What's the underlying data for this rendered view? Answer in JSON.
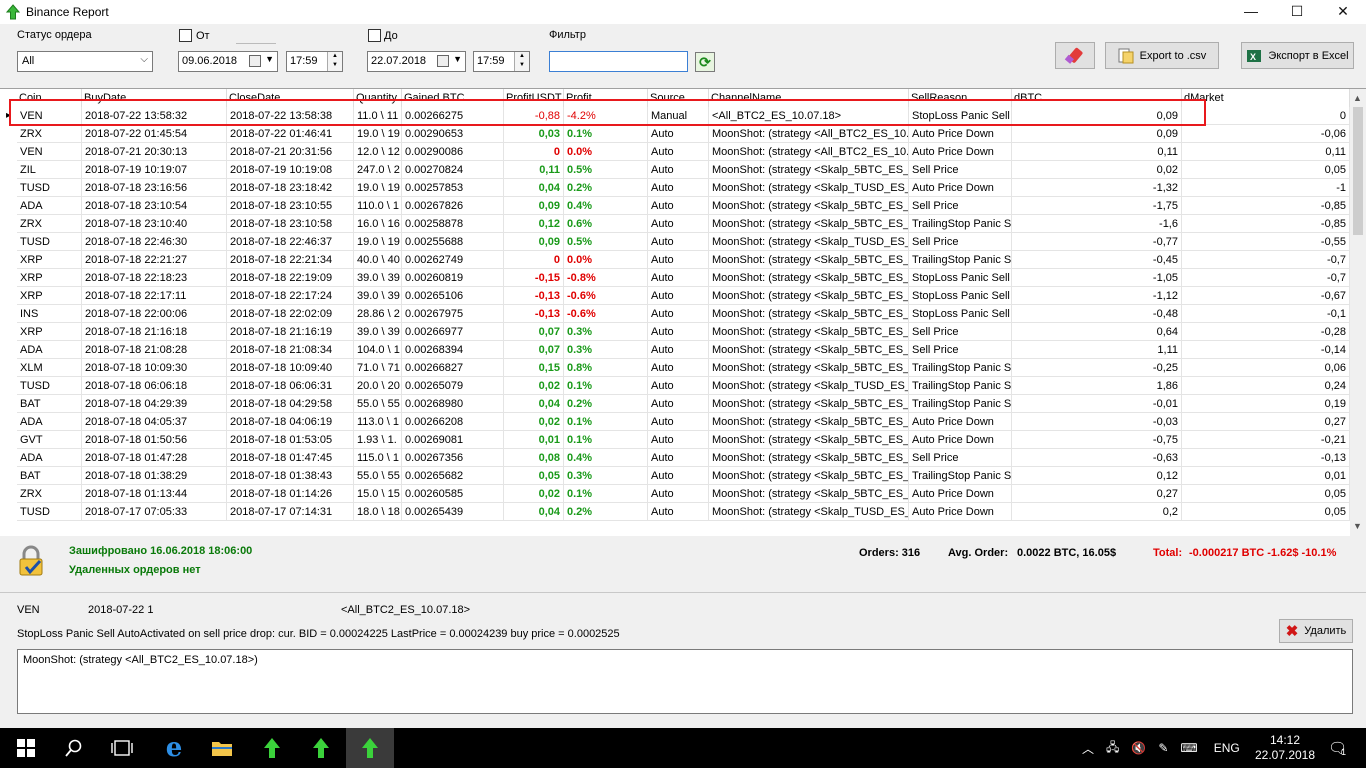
{
  "window": {
    "title": "Binance Report",
    "minimize": "—",
    "maximize": "☐",
    "close": "✕"
  },
  "filters": {
    "status_label": "Статус ордера",
    "status_value": "All",
    "from_label": "От",
    "from_date": "09.06.2018",
    "from_time": "17:59",
    "to_label": "До",
    "to_date": "22.07.2018",
    "to_time": "17:59",
    "filter_label": "Фильтр",
    "filter_value": ""
  },
  "buttons": {
    "export_csv": "Export to .csv",
    "export_excel": "Экспорт в Excel",
    "delete": "Удалить"
  },
  "columns": [
    "Coin",
    "BuyDate",
    "CloseDate",
    "Quantity",
    "Gained BTC",
    "ProfitUSDT",
    "Profit",
    "Source",
    "ChannelName",
    "SellReason",
    "dBTC",
    "dMarket"
  ],
  "rows": [
    [
      "VEN",
      "2018-07-22 13:58:32",
      "2018-07-22 13:58:38",
      "11.0 \\ 11",
      "0.00266275",
      "-0,88",
      "-4.2%",
      "Manual",
      "<All_BTC2_ES_10.07.18>",
      "StopLoss Panic Sell A",
      "0,09",
      "0"
    ],
    [
      "ZRX",
      "2018-07-22 01:45:54",
      "2018-07-22 01:46:41",
      "19.0 \\ 19",
      "0.00290653",
      "0,03",
      "0.1%",
      "Auto",
      "MoonShot: (strategy <All_BTC2_ES_10.0",
      "Auto Price Down",
      "0,09",
      "-0,06"
    ],
    [
      "VEN",
      "2018-07-21 20:30:13",
      "2018-07-21 20:31:56",
      "12.0 \\ 12",
      "0.00290086",
      "0",
      "0.0%",
      "Auto",
      "MoonShot: (strategy <All_BTC2_ES_10.0",
      "Auto Price Down",
      "0,11",
      "0,11"
    ],
    [
      "ZIL",
      "2018-07-19 10:19:07",
      "2018-07-19 10:19:08",
      "247.0 \\ 2",
      "0.00270824",
      "0,11",
      "0.5%",
      "Auto",
      "MoonShot: (strategy <Skalp_5BTC_ES_0",
      "Sell Price",
      "0,02",
      "0,05"
    ],
    [
      "TUSD",
      "2018-07-18 23:16:56",
      "2018-07-18 23:18:42",
      "19.0 \\ 19",
      "0.00257853",
      "0,04",
      "0.2%",
      "Auto",
      "MoonShot: (strategy <Skalp_TUSD_ES_(",
      "Auto Price Down",
      "-1,32",
      "-1"
    ],
    [
      "ADA",
      "2018-07-18 23:10:54",
      "2018-07-18 23:10:55",
      "110.0 \\ 1",
      "0.00267826",
      "0,09",
      "0.4%",
      "Auto",
      "MoonShot: (strategy <Skalp_5BTC_ES_0",
      "Sell Price",
      "-1,75",
      "-0,85"
    ],
    [
      "ZRX",
      "2018-07-18 23:10:40",
      "2018-07-18 23:10:58",
      "16.0 \\ 16",
      "0.00258878",
      "0,12",
      "0.6%",
      "Auto",
      "MoonShot: (strategy <Skalp_5BTC_ES_0",
      "TrailingStop Panic Se",
      "-1,6",
      "-0,85"
    ],
    [
      "TUSD",
      "2018-07-18 22:46:30",
      "2018-07-18 22:46:37",
      "19.0 \\ 19",
      "0.00255688",
      "0,09",
      "0.5%",
      "Auto",
      "MoonShot: (strategy <Skalp_TUSD_ES_(",
      "Sell Price",
      "-0,77",
      "-0,55"
    ],
    [
      "XRP",
      "2018-07-18 22:21:27",
      "2018-07-18 22:21:34",
      "40.0 \\ 40",
      "0.00262749",
      "0",
      "0.0%",
      "Auto",
      "MoonShot: (strategy <Skalp_5BTC_ES_0",
      "TrailingStop Panic Se",
      "-0,45",
      "-0,7"
    ],
    [
      "XRP",
      "2018-07-18 22:18:23",
      "2018-07-18 22:19:09",
      "39.0 \\ 39",
      "0.00260819",
      "-0,15",
      "-0.8%",
      "Auto",
      "MoonShot: (strategy <Skalp_5BTC_ES_0",
      "StopLoss Panic Sell A",
      "-1,05",
      "-0,7"
    ],
    [
      "XRP",
      "2018-07-18 22:17:11",
      "2018-07-18 22:17:24",
      "39.0 \\ 39",
      "0.00265106",
      "-0,13",
      "-0.6%",
      "Auto",
      "MoonShot: (strategy <Skalp_5BTC_ES_0",
      "StopLoss Panic Sell A",
      "-1,12",
      "-0,67"
    ],
    [
      "INS",
      "2018-07-18 22:00:06",
      "2018-07-18 22:02:09",
      "28.86 \\ 2",
      "0.00267975",
      "-0,13",
      "-0.6%",
      "Auto",
      "MoonShot: (strategy <Skalp_5BTC_ES_0",
      "StopLoss Panic Sell A",
      "-0,48",
      "-0,1"
    ],
    [
      "XRP",
      "2018-07-18 21:16:18",
      "2018-07-18 21:16:19",
      "39.0 \\ 39",
      "0.00266977",
      "0,07",
      "0.3%",
      "Auto",
      "MoonShot: (strategy <Skalp_5BTC_ES_0",
      "Sell Price",
      "0,64",
      "-0,28"
    ],
    [
      "ADA",
      "2018-07-18 21:08:28",
      "2018-07-18 21:08:34",
      "104.0 \\ 1",
      "0.00268394",
      "0,07",
      "0.3%",
      "Auto",
      "MoonShot: (strategy <Skalp_5BTC_ES_(",
      "Sell Price",
      "1,11",
      "-0,14"
    ],
    [
      "XLM",
      "2018-07-18 10:09:30",
      "2018-07-18 10:09:40",
      "71.0 \\ 71",
      "0.00266827",
      "0,15",
      "0.8%",
      "Auto",
      "MoonShot: (strategy <Skalp_5BTC_ES_0",
      "TrailingStop Panic Se",
      "-0,25",
      "0,06"
    ],
    [
      "TUSD",
      "2018-07-18 06:06:18",
      "2018-07-18 06:06:31",
      "20.0 \\ 20",
      "0.00265079",
      "0,02",
      "0.1%",
      "Auto",
      "MoonShot: (strategy <Skalp_TUSD_ES_(",
      "TrailingStop Panic Se",
      "1,86",
      "0,24"
    ],
    [
      "BAT",
      "2018-07-18 04:29:39",
      "2018-07-18 04:29:58",
      "55.0 \\ 55",
      "0.00268980",
      "0,04",
      "0.2%",
      "Auto",
      "MoonShot: (strategy <Skalp_5BTC_ES_0",
      "TrailingStop Panic Se",
      "-0,01",
      "0,19"
    ],
    [
      "ADA",
      "2018-07-18 04:05:37",
      "2018-07-18 04:06:19",
      "113.0 \\ 1",
      "0.00266208",
      "0,02",
      "0.1%",
      "Auto",
      "MoonShot: (strategy <Skalp_5BTC_ES_0",
      "Auto Price Down",
      "-0,03",
      "0,27"
    ],
    [
      "GVT",
      "2018-07-18 01:50:56",
      "2018-07-18 01:53:05",
      "1.93 \\ 1.",
      "0.00269081",
      "0,01",
      "0.1%",
      "Auto",
      "MoonShot: (strategy <Skalp_5BTC_ES_0",
      "Auto Price Down",
      "-0,75",
      "-0,21"
    ],
    [
      "ADA",
      "2018-07-18 01:47:28",
      "2018-07-18 01:47:45",
      "115.0 \\ 1",
      "0.00267356",
      "0,08",
      "0.4%",
      "Auto",
      "MoonShot: (strategy <Skalp_5BTC_ES_0",
      "Sell Price",
      "-0,63",
      "-0,13"
    ],
    [
      "BAT",
      "2018-07-18 01:38:29",
      "2018-07-18 01:38:43",
      "55.0 \\ 55",
      "0.00265682",
      "0,05",
      "0.3%",
      "Auto",
      "MoonShot: (strategy <Skalp_5BTC_ES_0",
      "TrailingStop Panic Se",
      "0,12",
      "0,01"
    ],
    [
      "ZRX",
      "2018-07-18 01:13:44",
      "2018-07-18 01:14:26",
      "15.0 \\ 15",
      "0.00260585",
      "0,02",
      "0.1%",
      "Auto",
      "MoonShot: (strategy <Skalp_5BTC_ES_0",
      "Auto Price Down",
      "0,27",
      "0,05"
    ],
    [
      "TUSD",
      "2018-07-17 07:05:33",
      "2018-07-17 07:14:31",
      "18.0 \\ 18",
      "0.00265439",
      "0,04",
      "0.2%",
      "Auto",
      "MoonShot: (strategy <Skalp_TUSD_ES_(",
      "Auto Price Down",
      "0,2",
      "0,05"
    ]
  ],
  "status": {
    "encrypted": "Зашифровано 16.06.2018 18:06:00",
    "deleted": "Удаленных ордеров нет",
    "orders": "Orders: 316",
    "avg_label": "Avg. Order:",
    "avg_value": "0.0022 BTC,  16.05$",
    "total_label": "Total:",
    "total_value": "-0.000217 BTC  -1.62$  -10.1%"
  },
  "details": {
    "coin": "VEN",
    "date": "2018-07-22 1",
    "channel": "<All_BTC2_ES_10.07.18>",
    "reason": "StopLoss Panic Sell AutoActivated on sell price drop: cur. BID = 0.00024225 LastPrice = 0.00024239 buy price = 0.0002525",
    "memo": "MoonShot: (strategy <All_BTC2_ES_10.07.18>)"
  },
  "taskbar": {
    "lang": "ENG",
    "time": "14:12",
    "date": "22.07.2018",
    "notifications": "1"
  }
}
